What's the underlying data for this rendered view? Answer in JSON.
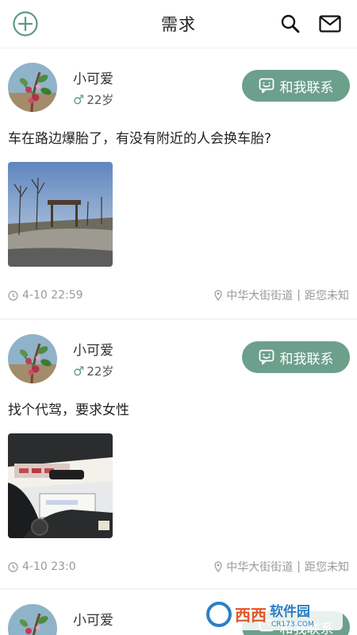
{
  "header": {
    "title": "需求",
    "icons": [
      "add-circle-icon",
      "search-icon",
      "mail-icon"
    ]
  },
  "posts": [
    {
      "user": {
        "name": "小可爱",
        "age": "22岁",
        "gender_symbol": "♂"
      },
      "contact_label": "和我联系",
      "text": "车在路边爆胎了，有没有附近的人会换车胎?",
      "time": "4-10 22:59",
      "location": "中华大街街道",
      "distance": "距您未知"
    },
    {
      "user": {
        "name": "小可爱",
        "age": "22岁",
        "gender_symbol": "♂"
      },
      "contact_label": "和我联系",
      "text": "找个代驾，要求女性",
      "time": "4-10 23:0",
      "location": "中华大街街道",
      "distance": "距您未知"
    },
    {
      "user": {
        "name": "小可爱"
      },
      "contact_label": "和我联系"
    }
  ],
  "watermark": {
    "brand": "西西软件园",
    "url": "CR173.COM"
  },
  "colors": {
    "accent": "#6c9f8c",
    "background": "#f2f2f2",
    "meta_text": "#999999"
  }
}
